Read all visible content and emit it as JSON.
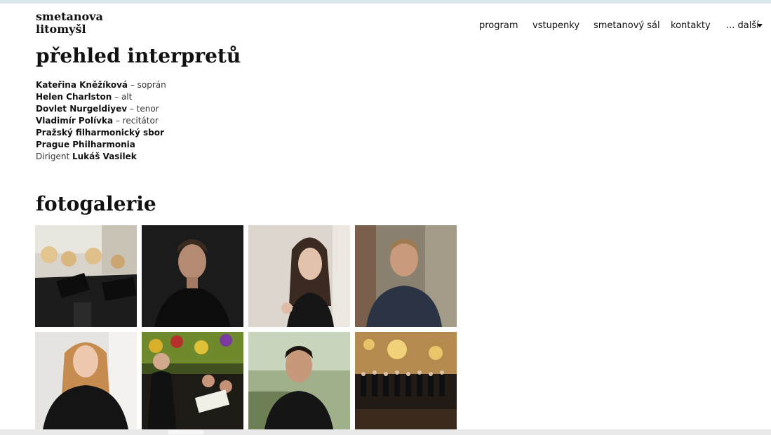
{
  "header": {
    "logo_line1": "smetanova",
    "logo_line2": "litomyšl",
    "nav": [
      {
        "label": "program"
      },
      {
        "label": "vstupenky"
      },
      {
        "label": "smetanový sál"
      },
      {
        "label": "kontakty"
      },
      {
        "label": "... další"
      }
    ]
  },
  "performers_section": {
    "title": "přehled interpretů",
    "items": [
      {
        "prefix": "",
        "name": "Kateřina Kněžíková",
        "role": " – soprán"
      },
      {
        "prefix": "",
        "name": "Helen Charlston",
        "role": " – alt"
      },
      {
        "prefix": "",
        "name": "Dovlet Nurgeldiyev",
        "role": " – tenor"
      },
      {
        "prefix": "",
        "name": "Vladimír Polívka",
        "role": " – recitátor"
      },
      {
        "prefix": "",
        "name": "Pražský filharmonický sbor",
        "role": ""
      },
      {
        "prefix": "",
        "name": "Prague Philharmonia",
        "role": ""
      },
      {
        "prefix": "Dirigent ",
        "name": "Lukáš Vasilek",
        "role": ""
      }
    ]
  },
  "gallery": {
    "title": "fotogalerie",
    "photos": [
      {
        "subject": "choir-women-in-hall"
      },
      {
        "subject": "man-portrait-dark"
      },
      {
        "subject": "woman-portrait-light"
      },
      {
        "subject": "man-portrait-wall"
      },
      {
        "subject": "woman-portrait-black-dress"
      },
      {
        "subject": "choir-with-conductor"
      },
      {
        "subject": "man-portrait-outdoor"
      },
      {
        "subject": "orchestra-in-hall"
      }
    ]
  },
  "colors": {
    "top_line": "#dbe7ea",
    "text": "#111111"
  }
}
